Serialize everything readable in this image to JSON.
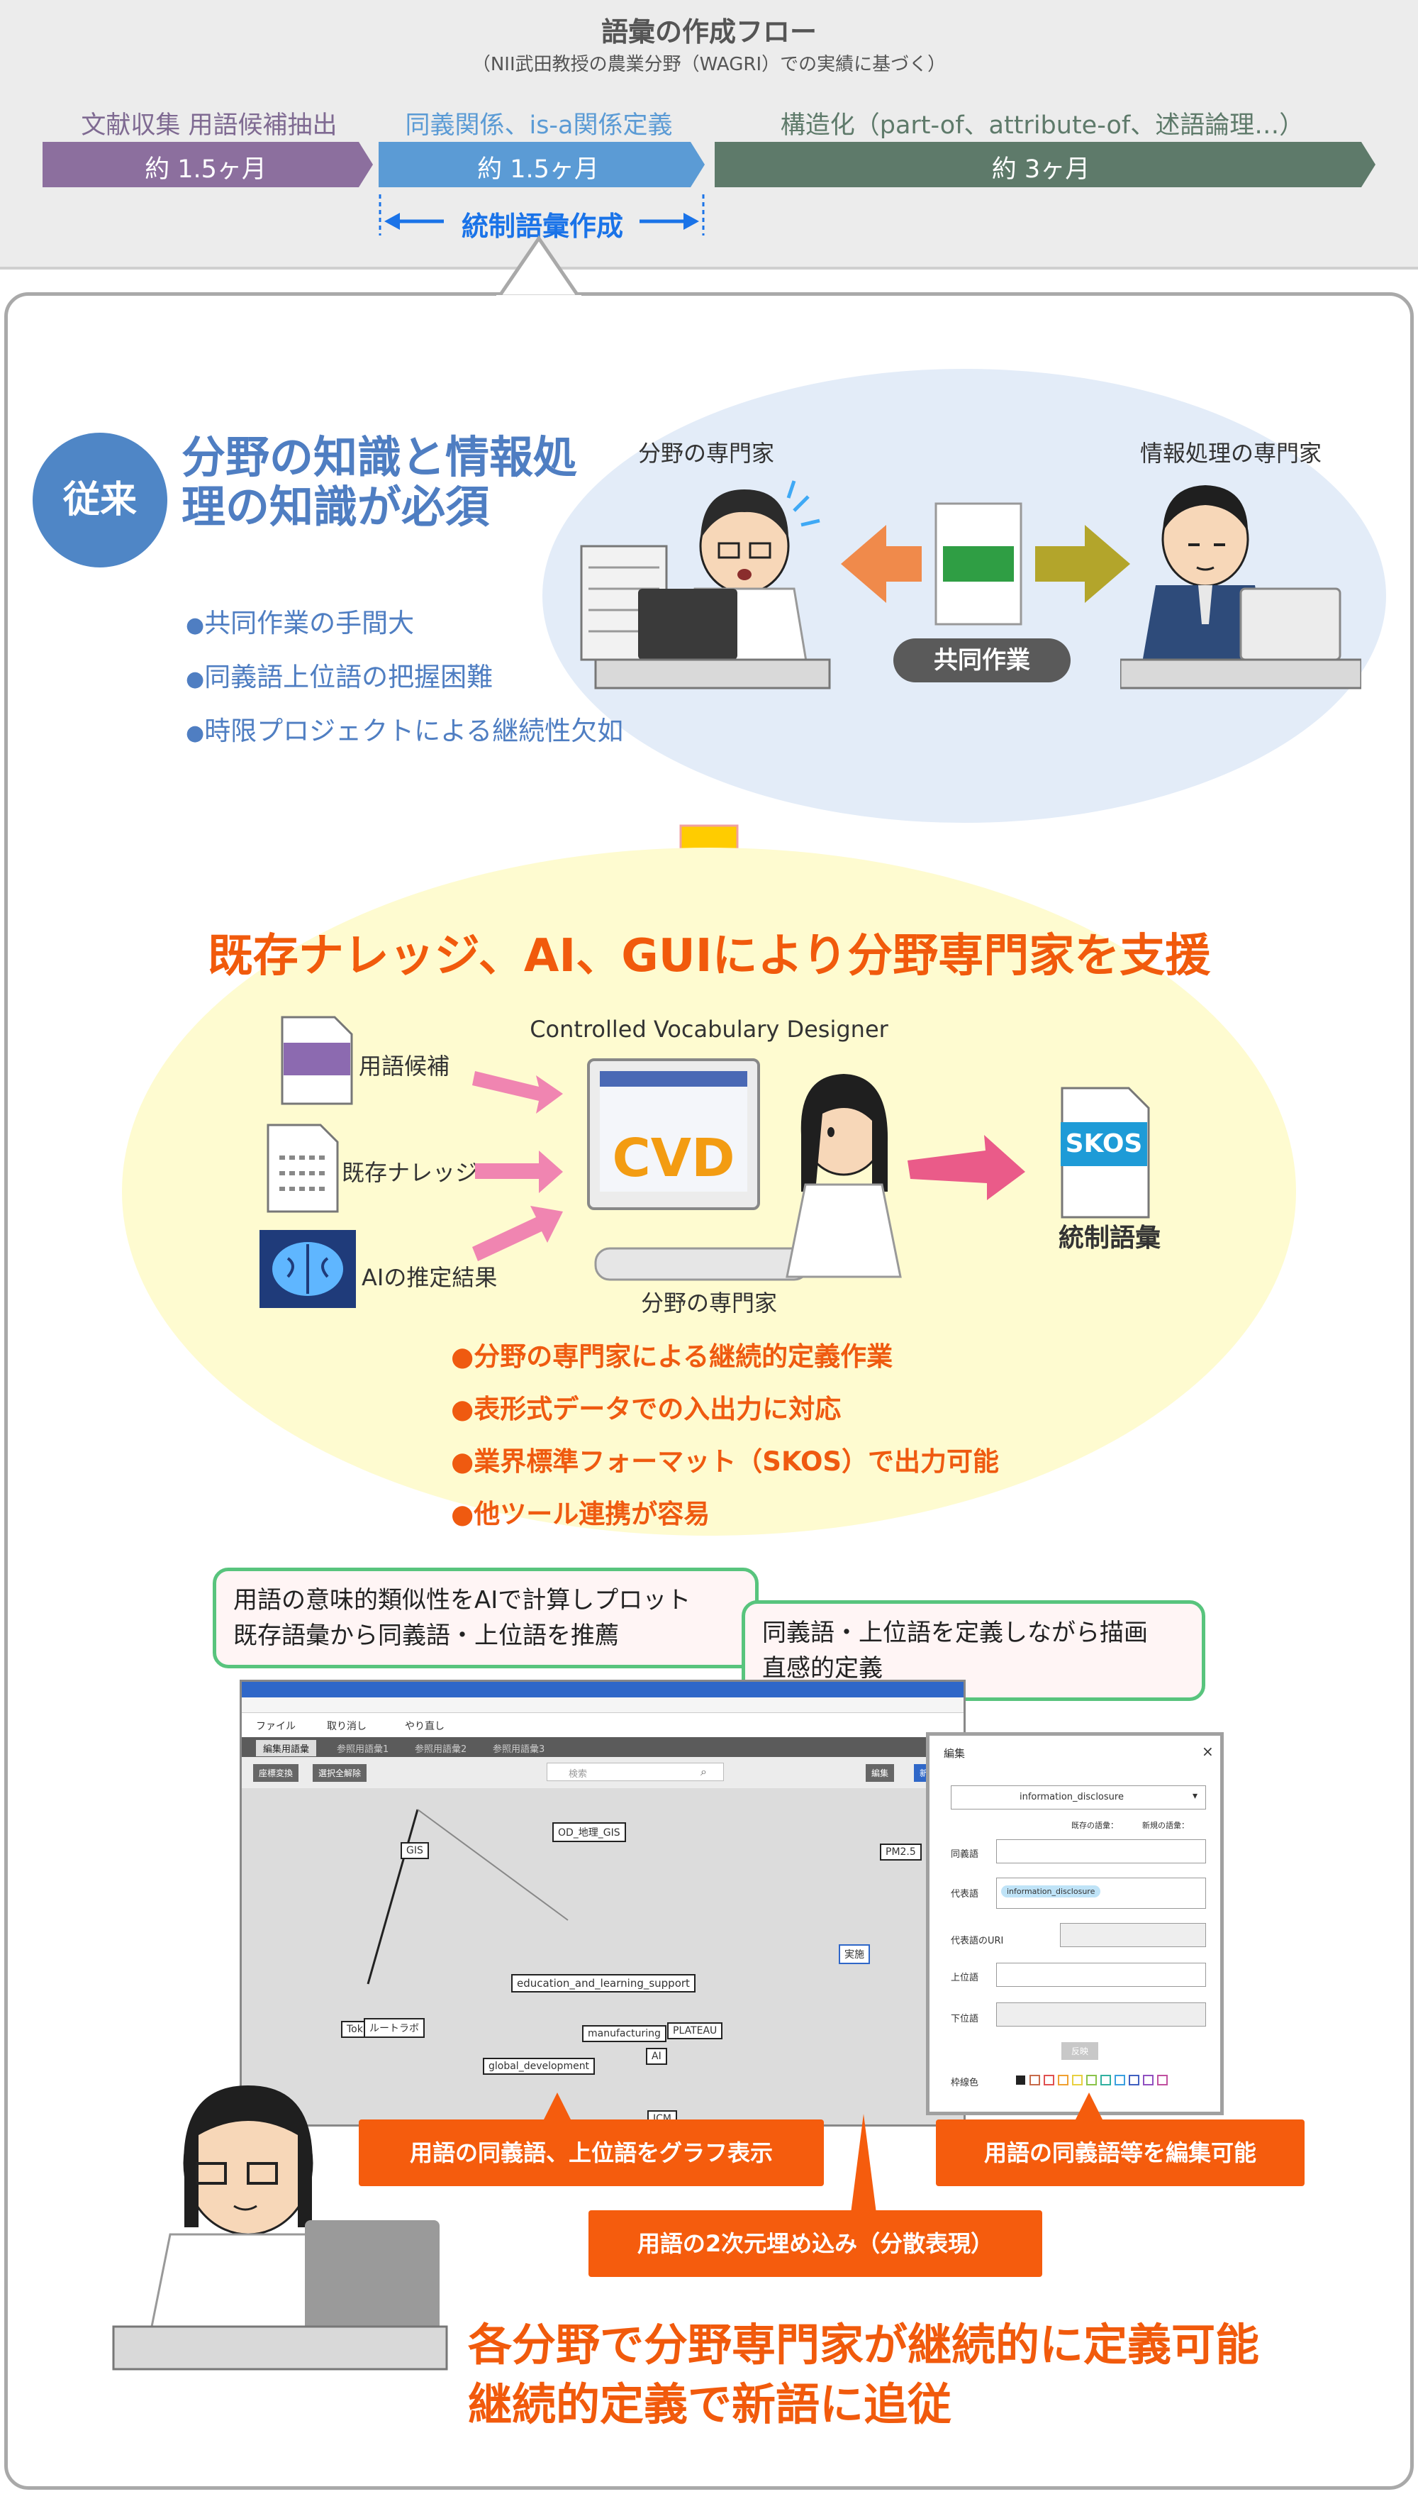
{
  "flow": {
    "title": "語彙の作成フロー",
    "subtitle": "（NII武田教授の農業分野（WAGRI）での実績に基づく）",
    "phases": [
      {
        "label": "文献収集 用語候補抽出",
        "duration": "約 1.5ヶ月",
        "color": "#8c6f9e"
      },
      {
        "label": "同義関係、is-a関係定義",
        "duration": "約 1.5ヶ月",
        "color": "#5b9bd5"
      },
      {
        "label": "構造化（part-of、attribute-of、述語論理…）",
        "duration": "約 3ヶ月",
        "color": "#5e7a6a"
      }
    ],
    "span_label": "統制語彙作成"
  },
  "conventional": {
    "badge": "従来",
    "headline": "分野の知識と情報処理の知識が必須",
    "bullets": [
      "共同作業の手間大",
      "同義語上位語の把握困難",
      "時限プロジェクトによる継続性欠如"
    ],
    "expert_domain_label": "分野の専門家",
    "expert_it_label": "情報処理の専門家",
    "collab_label": "共同作業"
  },
  "support": {
    "headline": "既存ナレッジ、AI、GUIにより分野専門家を支援",
    "tool_name": "Controlled Vocabulary Designer",
    "tool_logo": "CVD",
    "inputs": [
      "用語候補",
      "既存ナレッジ",
      "AIの推定結果"
    ],
    "domain_expert_label": "分野の専門家",
    "skos_badge": "SKOS",
    "output_label": "統制語彙",
    "bullets": [
      "分野の専門家による継続的定義作業",
      "表形式データでの入出力に対応",
      "業界標準フォーマット（SKOS）で出力可能",
      "他ツール連携が容易"
    ]
  },
  "callouts": {
    "ai_plot": [
      "用語の意味的類似性をAIで計算しプロット",
      "既存語彙から同義語・上位語を推薦"
    ],
    "define": [
      "同義語・上位語を定義しながら描画",
      "直感的定義"
    ]
  },
  "gui": {
    "menu": [
      "ファイル",
      "取り消し",
      "やり直し"
    ],
    "tabs": [
      "編集用語彙",
      "参照用語彙1",
      "参照用語彙2",
      "参照用語彙3"
    ],
    "buttons": [
      "座標変換",
      "選択全解除",
      "編集",
      "新規登録"
    ],
    "search_placeholder": "検索",
    "nodes": [
      "OD_地理_GIS",
      "GIS",
      "PM2.5",
      "education_and_learning_support",
      "実施",
      "Toki",
      "ルートラボ",
      "manufacturing",
      "PLATEAU",
      "global_development",
      "JCM",
      "AI"
    ],
    "edit_panel": {
      "title": "編集",
      "selected": "information_disclosure",
      "labels": [
        "同義語",
        "代表語",
        "代表語のURI",
        "上位語",
        "下位語",
        "枠線色"
      ],
      "tag": "information_disclosure",
      "legend": [
        "既存の語彙：",
        "新規の語彙："
      ],
      "apply_button": "反映"
    }
  },
  "feature_labels": [
    "用語の同義語、上位語をグラフ表示",
    "用語の同義語等を編集可能",
    "用語の2次元埋め込み（分散表現）"
  ],
  "final": [
    "各分野で分野専門家が継続的に定義可能",
    "継続的定義で新語に追従"
  ]
}
